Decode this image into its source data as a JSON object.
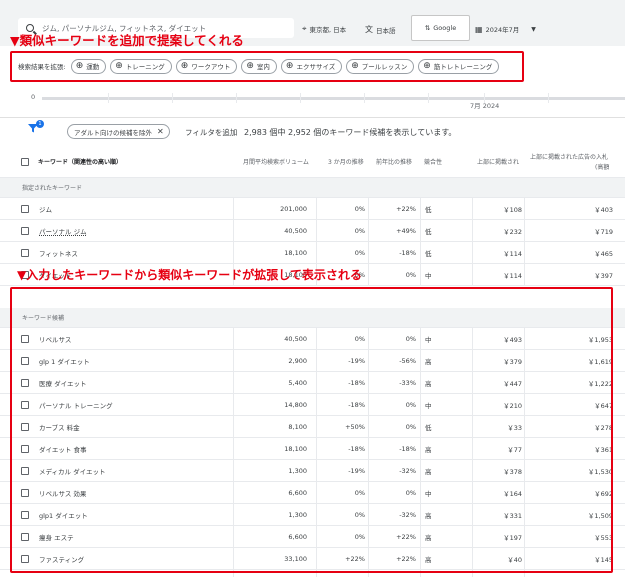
{
  "topbar": {
    "search_value": "ジム, パーソナルジム, フィットネス, ダイエット",
    "location": "東京都, 日本",
    "language": "日本語",
    "network": "Google",
    "date": "2024年7月"
  },
  "annotations": {
    "top": "▼類似キーワードを追加で提案してくれる",
    "middle": "▼入力したキーワードから類似キーワードが拡張して表示される"
  },
  "expand": {
    "label": "検索結果を拡張:",
    "chips": [
      "運動",
      "トレーニング",
      "ワークアウト",
      "室内",
      "エクササイズ",
      "プールレッスン",
      "筋トレトレーニング"
    ]
  },
  "chart": {
    "zero": "0",
    "date_label": "7月 2024"
  },
  "filter": {
    "badge": "1",
    "adult_chip": "アダルト向けの候補を除外",
    "add_filter": "フィルタを追加",
    "count_text": "2,983 個中 2,952 個のキーワード候補を表示しています。"
  },
  "table": {
    "headers": {
      "keyword": "キーワード（関連性の高い順）",
      "volume": "月間平均検索ボリューム",
      "trend3m": "3 か月の推移",
      "yoy": "前年比の推移",
      "competition": "競合性",
      "bid_low": "上部に掲載され",
      "bid_high": "上部に掲載された広告の入札",
      "bid_high_sub": "(高額"
    },
    "section_specified": "指定されたキーワード",
    "section_ideas": "キーワード候補",
    "specified_rows": [
      {
        "kw": "ジム",
        "vol": "201,000",
        "m3": "0%",
        "yoy": "+22%",
        "comp": "低",
        "low": "￥108",
        "high": "￥403"
      },
      {
        "kw": "パーソナル ジム",
        "vol": "40,500",
        "m3": "0%",
        "yoy": "+49%",
        "comp": "低",
        "low": "￥232",
        "high": "￥719"
      },
      {
        "kw": "フィットネス",
        "vol": "18,100",
        "m3": "0%",
        "yoy": "-18%",
        "comp": "低",
        "low": "￥114",
        "high": "￥465"
      },
      {
        "kw": "ダイエット",
        "vol": "18,100",
        "m3": "0%",
        "yoy": "0%",
        "comp": "中",
        "low": "￥114",
        "high": "￥397"
      }
    ],
    "idea_rows": [
      {
        "kw": "リベルサス",
        "vol": "40,500",
        "m3": "0%",
        "yoy": "0%",
        "comp": "中",
        "low": "￥493",
        "high": "￥1,953"
      },
      {
        "kw": "glp 1 ダイエット",
        "vol": "2,900",
        "m3": "-19%",
        "yoy": "-56%",
        "comp": "高",
        "low": "￥379",
        "high": "￥1,619"
      },
      {
        "kw": "医療 ダイエット",
        "vol": "5,400",
        "m3": "-18%",
        "yoy": "-33%",
        "comp": "高",
        "low": "￥447",
        "high": "￥1,222"
      },
      {
        "kw": "パーソナル トレーニング",
        "vol": "14,800",
        "m3": "-18%",
        "yoy": "0%",
        "comp": "中",
        "low": "￥210",
        "high": "￥647"
      },
      {
        "kw": "カーブス 料金",
        "vol": "8,100",
        "m3": "+50%",
        "yoy": "0%",
        "comp": "低",
        "low": "￥33",
        "high": "￥278"
      },
      {
        "kw": "ダイエット 食事",
        "vol": "18,100",
        "m3": "-18%",
        "yoy": "-18%",
        "comp": "高",
        "low": "￥77",
        "high": "￥361"
      },
      {
        "kw": "メディカル ダイエット",
        "vol": "1,300",
        "m3": "-19%",
        "yoy": "-32%",
        "comp": "高",
        "low": "￥378",
        "high": "￥1,530"
      },
      {
        "kw": "リベルサス 効果",
        "vol": "6,600",
        "m3": "0%",
        "yoy": "0%",
        "comp": "中",
        "low": "￥164",
        "high": "￥692"
      },
      {
        "kw": "glp1 ダイエット",
        "vol": "1,300",
        "m3": "0%",
        "yoy": "-32%",
        "comp": "高",
        "low": "￥331",
        "high": "￥1,509"
      },
      {
        "kw": "痩身 エステ",
        "vol": "6,600",
        "m3": "0%",
        "yoy": "+22%",
        "comp": "高",
        "low": "￥197",
        "high": "￥553"
      },
      {
        "kw": "ファスティング",
        "vol": "33,100",
        "m3": "+22%",
        "yoy": "+22%",
        "comp": "高",
        "low": "￥40",
        "high": "￥145"
      },
      {
        "kw": "漢方 ダイエット",
        "vol": "2,900",
        "m3": "-34%",
        "yoy": "-46%",
        "comp": "高",
        "low": "￥72",
        "high": "￥230"
      }
    ]
  }
}
